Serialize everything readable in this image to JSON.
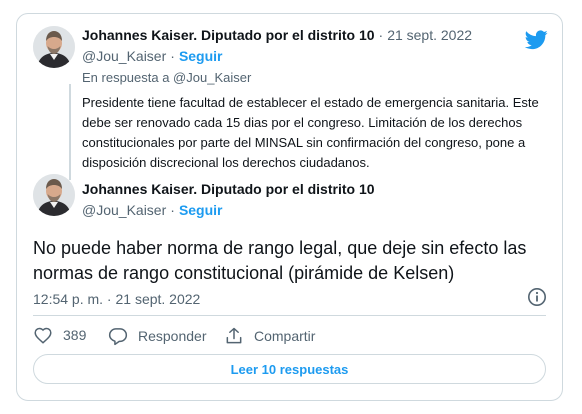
{
  "brand_color": "#1d9bf0",
  "quoted_tweet": {
    "author_name": "Johannes Kaiser. Diputado por el distrito 10",
    "separator": "·",
    "date": "21 sept. 2022",
    "handle": "@Jou_Kaiser",
    "follow_separator": "·",
    "follow_label": "Seguir",
    "reply_to": "En respuesta a @Jou_Kaiser",
    "text": "Presidente tiene facultad de establecer el estado de emergencia sanitaria. Este debe ser renovado cada 15 dias por el congreso. Limitación de los derechos constitucionales por parte del MINSAL sin confirmación del congreso, pone a disposición discrecional los derechos ciudadanos."
  },
  "main_tweet": {
    "author_name": "Johannes Kaiser. Diputado por el distrito 10",
    "handle": "@Jou_Kaiser",
    "follow_separator": "·",
    "follow_label": "Seguir",
    "text": "No puede haber norma de rango legal, que deje sin efecto las normas de rango constitucional (pirámide de Kelsen)",
    "timestamp": "12:54 p. m. · 21 sept. 2022",
    "like_count": "389",
    "reply_label": "Responder",
    "share_label": "Compartir",
    "read_replies_label": "Leer 10 respuestas"
  },
  "icons": {
    "logo": "twitter-bird-icon",
    "info": "info-icon",
    "like": "heart-icon",
    "reply": "reply-bubble-icon",
    "share": "share-upload-icon"
  }
}
